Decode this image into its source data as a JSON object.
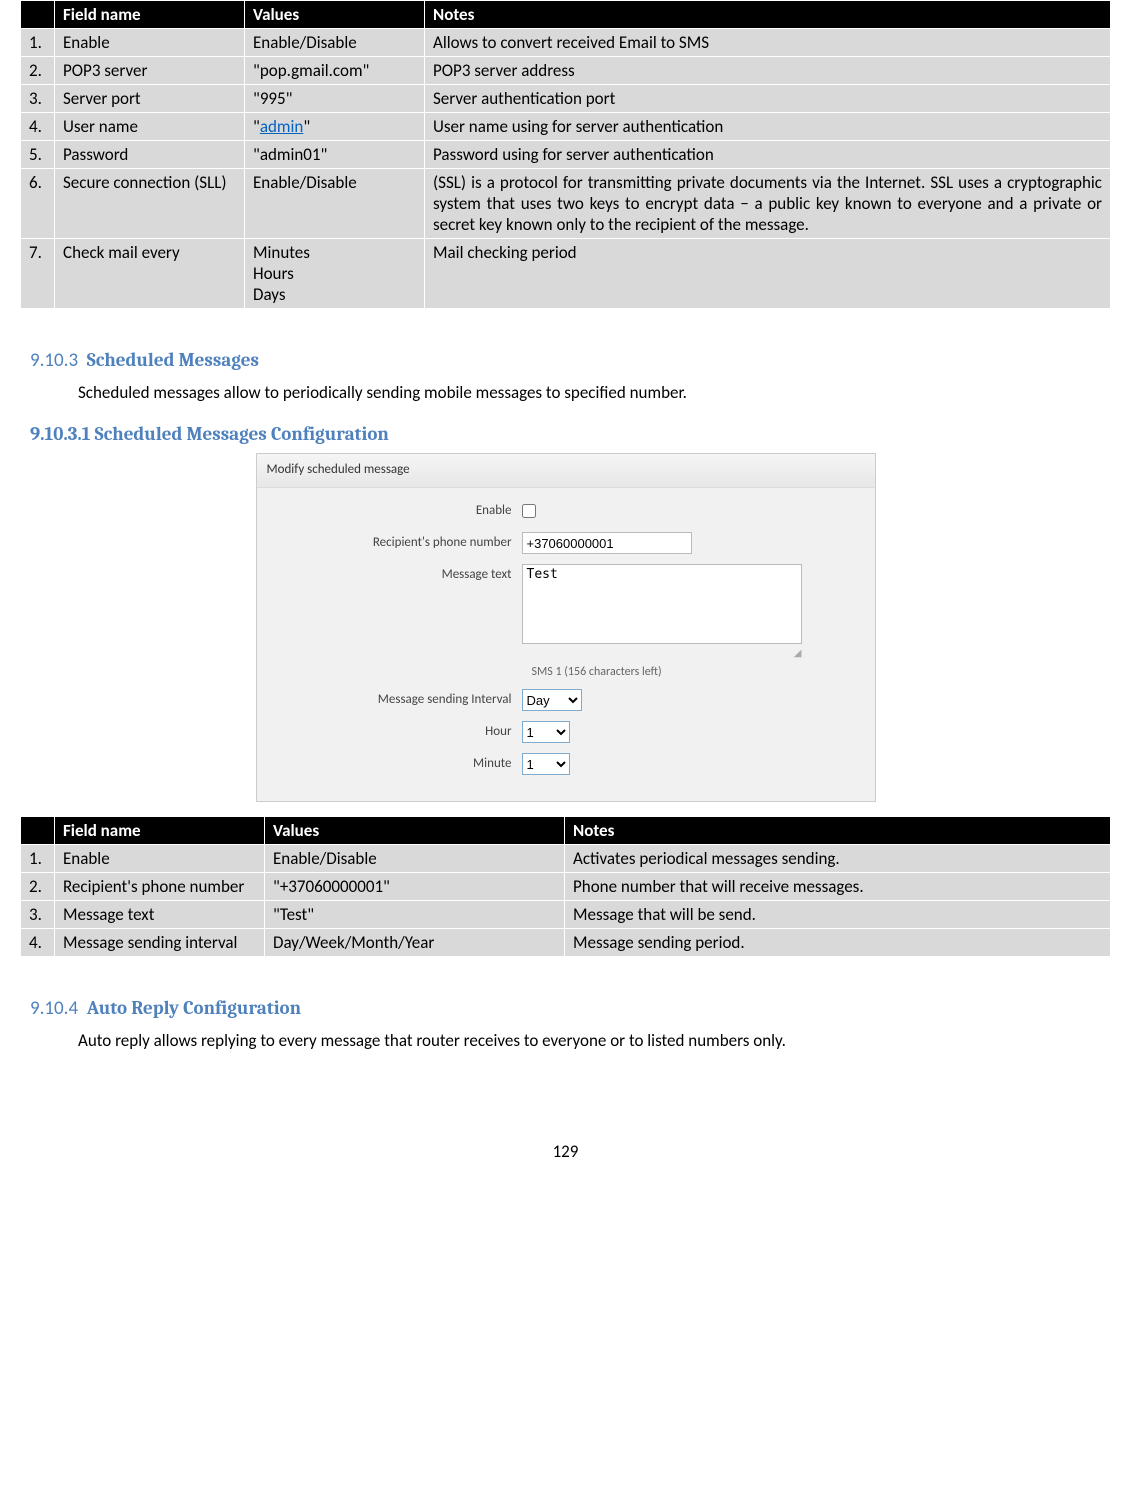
{
  "table1": {
    "headers": {
      "field": "Field name",
      "values": "Values",
      "notes": "Notes"
    },
    "rows": [
      {
        "n": "1.",
        "field": "Enable",
        "values": "Enable/Disable",
        "notes": "Allows to convert received Email to SMS"
      },
      {
        "n": "2.",
        "field": "POP3 server",
        "values": "\"pop.gmail.com\"",
        "notes": "POP3 server address"
      },
      {
        "n": "3.",
        "field": "Server port",
        "values": "\"995\"",
        "notes": "Server authentication port"
      },
      {
        "n": "4.",
        "field": "User name",
        "values_prefix": "\"",
        "values_link": "admin",
        "values_suffix": "\"",
        "notes": "User name using for server authentication"
      },
      {
        "n": "5.",
        "field": "Password",
        "values": "\"admin01\"",
        "notes": "Password using for server authentication"
      },
      {
        "n": "6.",
        "field": "Secure connection (SLL)",
        "values": "Enable/Disable",
        "notes": "(SSL) is a protocol for transmitting private documents via the Internet. SSL uses a cryptographic system that uses two keys to encrypt data − a public key known to everyone and a private or secret key known only to the recipient of the message."
      },
      {
        "n": "7.",
        "field": "Check mail every",
        "values_lines": [
          "Minutes",
          "Hours",
          "Days"
        ],
        "notes": "Mail checking period"
      }
    ]
  },
  "section1": {
    "num": "9.10.3",
    "title": "Scheduled Messages",
    "body": "Scheduled messages allow to periodically sending mobile messages to specified number."
  },
  "subsection1": {
    "title": "9.10.3.1 Scheduled Messages Configuration"
  },
  "formspec": {
    "title": "Modify scheduled message",
    "labels": {
      "enable": "Enable",
      "phone": "Recipient's phone number",
      "msg": "Message text",
      "interval": "Message sending Interval",
      "hour": "Hour",
      "minute": "Minute"
    },
    "values": {
      "phone": "+37060000001",
      "msg": "Test",
      "interval": "Day",
      "hour": "1",
      "minute": "1"
    },
    "charnote": "SMS 1 (156 characters left)"
  },
  "table2": {
    "headers": {
      "field": "Field name",
      "values": "Values",
      "notes": "Notes"
    },
    "rows": [
      {
        "n": "1.",
        "field": "Enable",
        "values": "Enable/Disable",
        "notes": "Activates periodical messages sending."
      },
      {
        "n": "2.",
        "field": "Recipient's phone number",
        "values": "\"+37060000001\"",
        "notes": "Phone number that will receive messages."
      },
      {
        "n": "3.",
        "field": "Message text",
        "values": "\"Test\"",
        "notes": "Message that will be send."
      },
      {
        "n": "4.",
        "field": "Message sending interval",
        "values": "Day/Week/Month/Year",
        "notes": "Message sending period."
      }
    ]
  },
  "section2": {
    "num": "9.10.4",
    "title": "Auto Reply Configuration",
    "body": "Auto reply allows replying to every message that router receives to everyone or to listed numbers only."
  },
  "page": "129"
}
